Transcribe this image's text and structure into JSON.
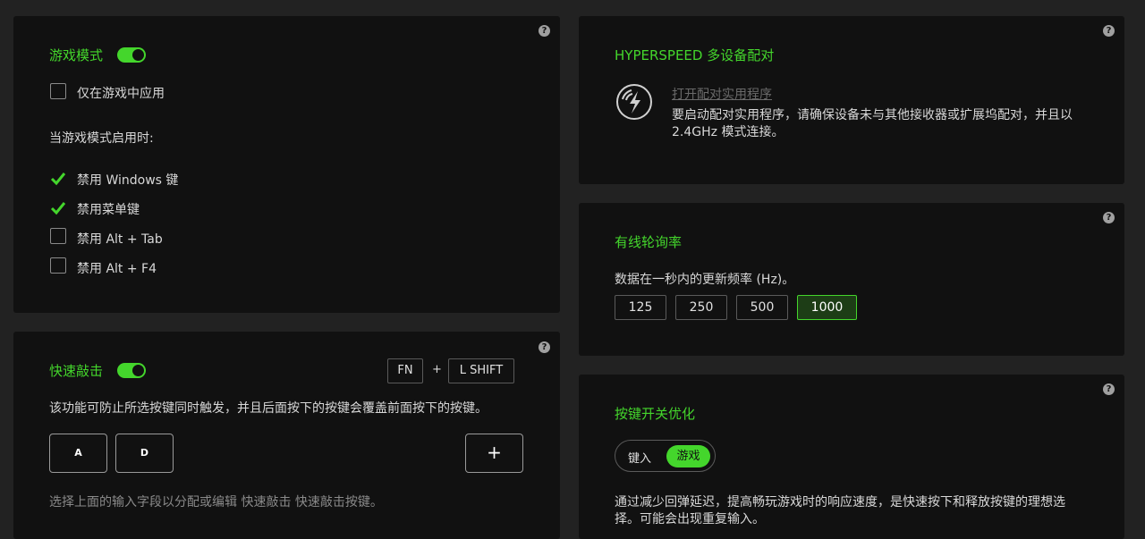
{
  "game_mode": {
    "title": "游戏模式",
    "toggle_on": true,
    "apply_only_in_game": "仅在游戏中应用",
    "when_enabled": "当游戏模式启用时:",
    "options": [
      {
        "label": "禁用 Windows 键",
        "checked": true
      },
      {
        "label": "禁用菜单键",
        "checked": true
      },
      {
        "label": "禁用 Alt + Tab",
        "checked": false
      },
      {
        "label": "禁用 Alt + F4",
        "checked": false
      }
    ]
  },
  "snap_tap": {
    "title": "快速敲击",
    "toggle_on": true,
    "shortcut_key1": "FN",
    "shortcut_plus": "+",
    "shortcut_key2": "L SHIFT",
    "description": "该功能可防止所选按键同时触发，并且后面按下的按键会覆盖前面按下的按键。",
    "key_a": "A",
    "key_d": "D",
    "add_label": "+",
    "hint": "选择上面的输入字段以分配或编辑 快速敲击 快速敲击按键。"
  },
  "hyperspeed": {
    "title": "HYPERSPEED 多设备配对",
    "link": "打开配对实用程序",
    "desc_line1": "要启动配对实用程序，请确保设备未与其他接收器或扩展坞配对，并且以",
    "desc_line2": "2.4GHz 模式连接。"
  },
  "polling": {
    "title": "有线轮询率",
    "desc": "数据在一秒内的更新频率 (Hz)。",
    "rates": [
      "125",
      "250",
      "500",
      "1000"
    ],
    "selected": "1000"
  },
  "key_switch": {
    "title": "按键开关优化",
    "option_typing": "键入",
    "option_gaming": "游戏",
    "selected": "游戏",
    "desc_line1": "通过减少回弹延迟，提高畅玩游戏时的响应速度，是快速按下和释放按键的理想选",
    "desc_line2": "择。可能会出现重复输入。"
  },
  "help_label": "?",
  "colors": {
    "accent": "#44d62c",
    "panel": "#111111",
    "background": "#222222"
  }
}
